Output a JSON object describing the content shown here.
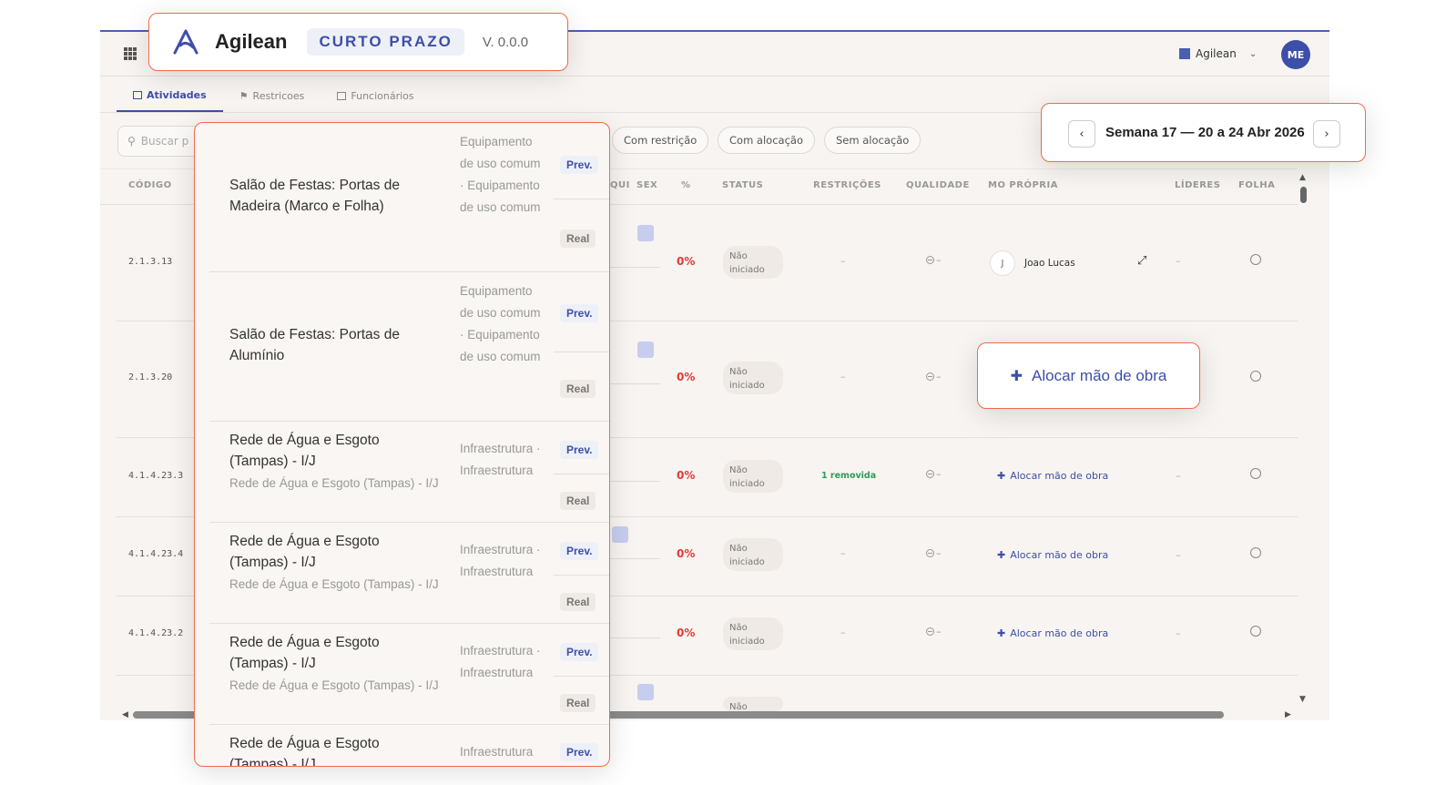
{
  "app": {
    "name": "Agilean",
    "module": "CURTO PRAZO",
    "version": "V. 0.0.0"
  },
  "header": {
    "company": "Agilean",
    "avatar_initials": "ME"
  },
  "tabs": [
    {
      "label": "Atividades",
      "active": true
    },
    {
      "label": "Restricoes",
      "active": false
    },
    {
      "label": "Funcionários",
      "active": false
    }
  ],
  "search": {
    "placeholder": "Buscar p"
  },
  "filters": [
    "Com restrição",
    "Com alocação",
    "Sem alocação"
  ],
  "week": {
    "label": "Semana 17 — 20 a 24 Abr 2026"
  },
  "columns": {
    "codigo": "CÓDIGO",
    "qui": "QUI",
    "sex": "SEX",
    "pct": "%",
    "status": "STATUS",
    "restricoes": "RESTRIÇÕES",
    "qualidade": "QUALIDADE",
    "mo_propria": "MO PRÓPRIA",
    "lideres": "LÍDERES",
    "folha": "FOLHA"
  },
  "rows": [
    {
      "code": "2.1.3.13",
      "pct": "0%",
      "status": "Não iniciado",
      "restricoes": "–",
      "qualidade": "–",
      "worker_initial": "J",
      "worker_name": "Joao Lucas",
      "lideres": "–"
    },
    {
      "code": "2.1.3.20",
      "pct": "0%",
      "status": "Não iniciado",
      "restricoes": "–",
      "qualidade": "–"
    },
    {
      "code": "4.1.4.23.3",
      "pct": "0%",
      "status": "Não iniciado",
      "restricoes": "1 removida",
      "qualidade": "–",
      "alloc": "Alocar mão de obra",
      "lideres": "–"
    },
    {
      "code": "4.1.4.23.4",
      "pct": "0%",
      "status": "Não iniciado",
      "restricoes": "–",
      "qualidade": "–",
      "alloc": "Alocar mão de obra",
      "lideres": "–"
    },
    {
      "code": "4.1.4.23.2",
      "pct": "0%",
      "status": "Não iniciado",
      "restricoes": "–",
      "qualidade": "–",
      "alloc": "Alocar mão de obra",
      "lideres": "–"
    },
    {
      "status": "Não"
    }
  ],
  "alloc_highlight": "Alocar mão de obra",
  "activities": [
    {
      "title": "Salão de Festas: Portas de Madeira (Marco e Folha)",
      "category": "Equipamento de uso comum · Equipamento de uso comum",
      "prev": "Prev.",
      "real": "Real"
    },
    {
      "title": "Salão de Festas: Portas de Alumínio",
      "category": "Equipamento de uso comum · Equipamento de uso comum",
      "prev": "Prev.",
      "real": "Real"
    },
    {
      "title": "Rede de Água e Esgoto (Tampas) - I/J",
      "subtitle": "Rede de Água e Esgoto (Tampas) - I/J",
      "category": "Infraestrutura · Infraestrutura",
      "prev": "Prev.",
      "real": "Real"
    },
    {
      "title": "Rede de Água e Esgoto (Tampas) - I/J",
      "subtitle": "Rede de Água e Esgoto (Tampas) - I/J",
      "category": "Infraestrutura · Infraestrutura",
      "prev": "Prev.",
      "real": "Real"
    },
    {
      "title": "Rede de Água e Esgoto (Tampas) - I/J",
      "subtitle": "Rede de Água e Esgoto (Tampas) - I/J",
      "category": "Infraestrutura · Infraestrutura",
      "prev": "Prev.",
      "real": "Real"
    },
    {
      "title": "Rede de Água e Esgoto (Tampas) - I/J",
      "category": "Infraestrutura",
      "prev": "Prev."
    }
  ],
  "colors": {
    "accent": "#3d4fa8",
    "danger": "#e53935",
    "success": "#2e9b5a",
    "highlight": "#ef6b4d"
  },
  "icons": [
    "apps-grid-icon",
    "building-icon",
    "chevron-down-icon",
    "list-icon",
    "flag-icon",
    "briefcase-icon",
    "search-icon",
    "chevron-left-icon",
    "chevron-right-icon",
    "user-plus-icon",
    "expand-icon",
    "minus-circle-icon"
  ]
}
